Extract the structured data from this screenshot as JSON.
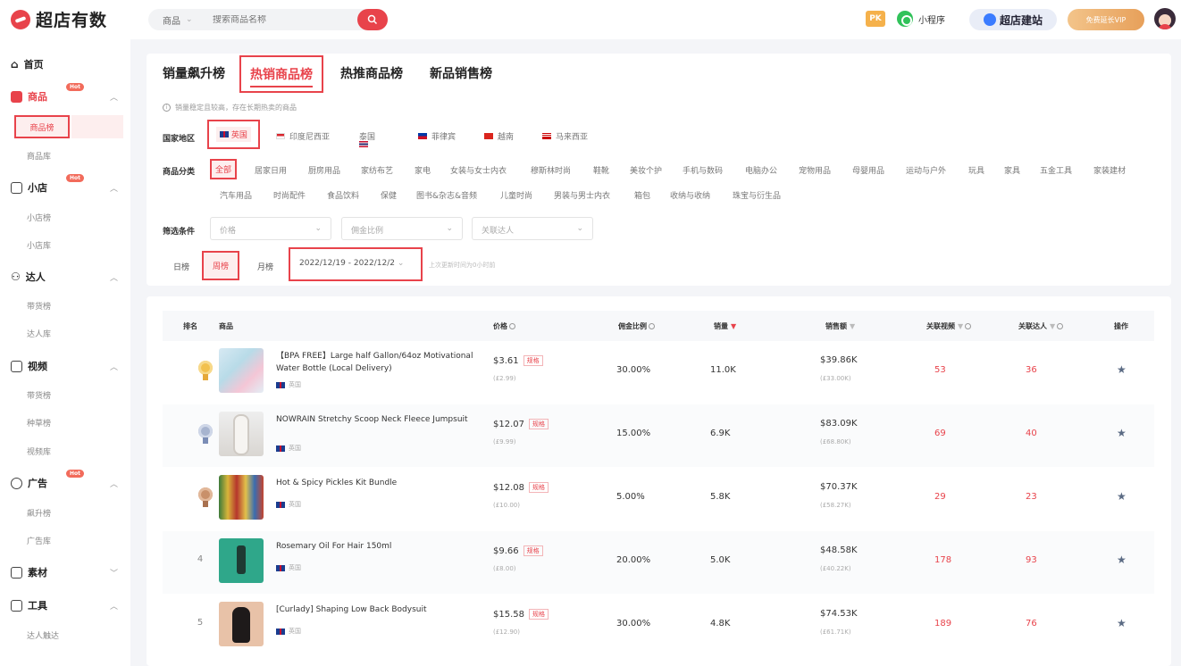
{
  "brand": {
    "name": "超店有数"
  },
  "search": {
    "category": "商品",
    "placeholder": "搜索商品名称"
  },
  "topbar": {
    "pk": "PK",
    "mini_program": "小程序",
    "build_site": "超店建站",
    "vip": "免费延长VIP"
  },
  "sidebar": {
    "home": "首页",
    "groups": [
      {
        "label": "商品",
        "hot": "Hot",
        "items": [
          "商品榜",
          "商品库"
        ]
      },
      {
        "label": "小店",
        "hot": "Hot",
        "items": [
          "小店榜",
          "小店库"
        ]
      },
      {
        "label": "达人",
        "items": [
          "带货榜",
          "达人库"
        ]
      },
      {
        "label": "视频",
        "items": [
          "带货榜",
          "种草榜",
          "视频库"
        ]
      },
      {
        "label": "广告",
        "hot": "Hot",
        "items": [
          "飙升榜",
          "广告库"
        ]
      },
      {
        "label": "素材",
        "items": []
      },
      {
        "label": "工具",
        "items": [
          "达人触达"
        ]
      }
    ]
  },
  "tabs": [
    "销量飙升榜",
    "热销商品榜",
    "热推商品榜",
    "新品销售榜"
  ],
  "active_tab": "热销商品榜",
  "tip": "销量稳定且较高，存在长期热卖的商品",
  "filters": {
    "country_label": "国家地区",
    "countries": [
      "英国",
      "印度尼西亚",
      "泰国",
      "菲律宾",
      "越南",
      "马来西亚"
    ],
    "category_label": "商品分类",
    "categories_row1": [
      "全部",
      "居家日用",
      "厨房用品",
      "家纺布艺",
      "家电",
      "女装与女士内衣",
      "穆斯林时尚",
      "鞋靴",
      "美妆个护",
      "手机与数码",
      "电脑办公",
      "宠物用品",
      "母婴用品",
      "运动与户外",
      "玩具",
      "家具",
      "五金工具",
      "家装建材"
    ],
    "categories_row2": [
      "汽车用品",
      "时尚配件",
      "食品饮料",
      "保健",
      "图书&杂志&音频",
      "儿童时尚",
      "男装与男士内衣",
      "箱包",
      "收纳与收纳",
      "珠宝与衍生品"
    ],
    "condition_label": "筛选条件",
    "selects": [
      "价格",
      "佣金比例",
      "关联达人"
    ],
    "periods": [
      "日榜",
      "周榜",
      "月榜"
    ],
    "date_range": "2022/12/19 - 2022/12/2",
    "update_note": "上次更新时间为0小时前"
  },
  "table": {
    "headers": {
      "rank": "排名",
      "product": "商品",
      "price": "价格",
      "commission": "佣金比例",
      "sales": "销量",
      "revenue": "销售额",
      "videos": "关联视频",
      "creators": "关联达人",
      "action": "操作"
    },
    "price_tag": "规格",
    "rows": [
      {
        "rank": "1",
        "name": "【BPA FREE】Large half Gallon/64oz Motivational Water Bottle (Local Delivery)",
        "country": "英国",
        "price": "$3.61",
        "price_local": "(£2.99)",
        "commission": "30.00%",
        "sales": "11.0K",
        "revenue": "$39.86K",
        "revenue_local": "(£33.00K)",
        "videos": "53",
        "creators": "36"
      },
      {
        "rank": "2",
        "name": "NOWRAIN Stretchy Scoop Neck Fleece Jumpsuit",
        "country": "英国",
        "price": "$12.07",
        "price_local": "(£9.99)",
        "commission": "15.00%",
        "sales": "6.9K",
        "revenue": "$83.09K",
        "revenue_local": "(£68.80K)",
        "videos": "69",
        "creators": "40"
      },
      {
        "rank": "3",
        "name": "Hot & Spicy Pickles Kit Bundle",
        "country": "英国",
        "price": "$12.08",
        "price_local": "(£10.00)",
        "commission": "5.00%",
        "sales": "5.8K",
        "revenue": "$70.37K",
        "revenue_local": "(£58.27K)",
        "videos": "29",
        "creators": "23"
      },
      {
        "rank": "4",
        "name": "Rosemary Oil For Hair 150ml",
        "country": "英国",
        "price": "$9.66",
        "price_local": "(£8.00)",
        "commission": "20.00%",
        "sales": "5.0K",
        "revenue": "$48.58K",
        "revenue_local": "(£40.22K)",
        "videos": "178",
        "creators": "93"
      },
      {
        "rank": "5",
        "name": "[Curlady] Shaping Low Back Bodysuit",
        "country": "英国",
        "price": "$15.58",
        "price_local": "(£12.90)",
        "commission": "30.00%",
        "sales": "4.8K",
        "revenue": "$74.53K",
        "revenue_local": "(£61.71K)",
        "videos": "189",
        "creators": "76"
      }
    ]
  },
  "colors": {
    "accent": "#e8434b",
    "link_red": "#e8434b",
    "background": "#f4f5f8"
  }
}
